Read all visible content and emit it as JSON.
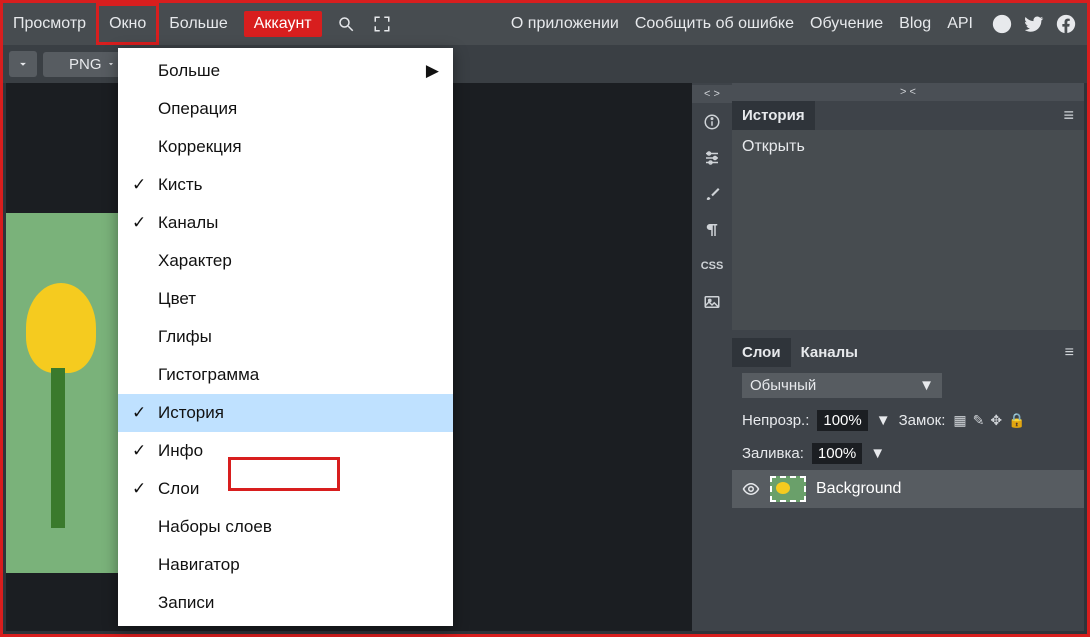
{
  "menubar": {
    "items": [
      "Просмотр",
      "Окно",
      "Больше",
      "Аккаунт"
    ],
    "right": [
      "О приложении",
      "Сообщить об ошибке",
      "Обучение",
      "Blog",
      "API"
    ]
  },
  "toolbar2": {
    "png_label": "PNG"
  },
  "dropdown": {
    "items": [
      {
        "label": "Больше",
        "check": false,
        "arrow": true
      },
      {
        "label": "Операция",
        "check": false
      },
      {
        "label": "Коррекция",
        "check": false
      },
      {
        "label": "Кисть",
        "check": true
      },
      {
        "label": "Каналы",
        "check": true
      },
      {
        "label": "Характер",
        "check": false
      },
      {
        "label": "Цвет",
        "check": false
      },
      {
        "label": "Глифы",
        "check": false
      },
      {
        "label": "Гистограмма",
        "check": false
      },
      {
        "label": "История",
        "check": true,
        "hover": true,
        "redbox": true
      },
      {
        "label": "Инфо",
        "check": true
      },
      {
        "label": "Слои",
        "check": true
      },
      {
        "label": "Наборы слоев",
        "check": false
      },
      {
        "label": "Навигатор",
        "check": false
      },
      {
        "label": "Записи",
        "check": false
      }
    ]
  },
  "toolstrip": {
    "head": "< >"
  },
  "history_panel": {
    "head": "> <",
    "tab": "История",
    "entry": "Открыть"
  },
  "layers_panel": {
    "tabs": [
      "Слои",
      "Каналы"
    ],
    "blend_mode": "Обычный",
    "opacity_label": "Непрозр.:",
    "opacity_value": "100%",
    "lock_label": "Замок:",
    "fill_label": "Заливка:",
    "fill_value": "100%",
    "layer_name": "Background"
  }
}
